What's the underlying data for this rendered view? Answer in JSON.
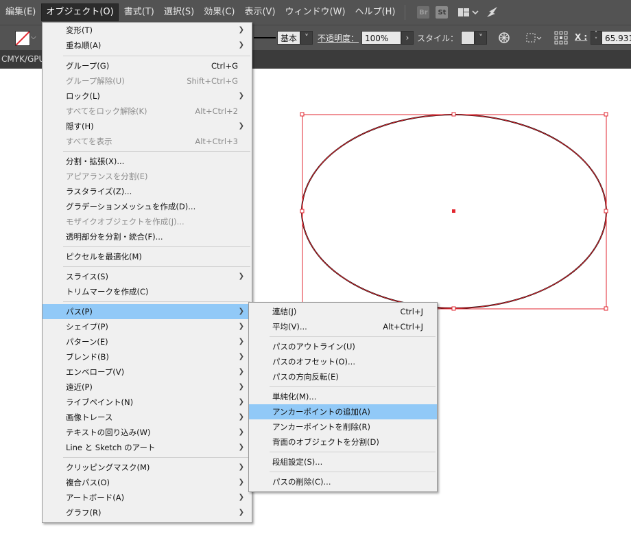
{
  "menubar": {
    "items": [
      "編集(E)",
      "オブジェクト(O)",
      "書式(T)",
      "選択(S)",
      "効果(C)",
      "表示(V)",
      "ウィンドウ(W)",
      "ヘルプ(H)"
    ],
    "active_index": 1,
    "bridge_icon": "Br",
    "stock_icon": "St"
  },
  "controlbar": {
    "stroke_profile_label": "基本",
    "opacity_label": "不透明度：",
    "opacity_value": "100%",
    "style_label": "スタイル：",
    "x_label": "X :",
    "x_value": "65.931"
  },
  "document": {
    "tab_title": "CMYK/GPU"
  },
  "object_menu": {
    "items": [
      {
        "label": "変形(T)",
        "shortcut": "",
        "submenu": true,
        "enabled": true
      },
      {
        "label": "重ね順(A)",
        "shortcut": "",
        "submenu": true,
        "enabled": true
      },
      {
        "label": "グループ(G)",
        "shortcut": "Ctrl+G",
        "submenu": false,
        "enabled": true
      },
      {
        "label": "グループ解除(U)",
        "shortcut": "Shift+Ctrl+G",
        "submenu": false,
        "enabled": false
      },
      {
        "label": "ロック(L)",
        "shortcut": "",
        "submenu": true,
        "enabled": true
      },
      {
        "label": "すべてをロック解除(K)",
        "shortcut": "Alt+Ctrl+2",
        "submenu": false,
        "enabled": false
      },
      {
        "label": "隠す(H)",
        "shortcut": "",
        "submenu": true,
        "enabled": true
      },
      {
        "label": "すべてを表示",
        "shortcut": "Alt+Ctrl+3",
        "submenu": false,
        "enabled": false
      },
      {
        "label": "分割・拡張(X)...",
        "shortcut": "",
        "submenu": false,
        "enabled": true
      },
      {
        "label": "アピアランスを分割(E)",
        "shortcut": "",
        "submenu": false,
        "enabled": false
      },
      {
        "label": "ラスタライズ(Z)...",
        "shortcut": "",
        "submenu": false,
        "enabled": true
      },
      {
        "label": "グラデーションメッシュを作成(D)...",
        "shortcut": "",
        "submenu": false,
        "enabled": true
      },
      {
        "label": "モザイクオブジェクトを作成(J)...",
        "shortcut": "",
        "submenu": false,
        "enabled": false
      },
      {
        "label": "透明部分を分割・統合(F)...",
        "shortcut": "",
        "submenu": false,
        "enabled": true
      },
      {
        "label": "ピクセルを最適化(M)",
        "shortcut": "",
        "submenu": false,
        "enabled": true
      },
      {
        "label": "スライス(S)",
        "shortcut": "",
        "submenu": true,
        "enabled": true
      },
      {
        "label": "トリムマークを作成(C)",
        "shortcut": "",
        "submenu": false,
        "enabled": true
      },
      {
        "label": "パス(P)",
        "shortcut": "",
        "submenu": true,
        "enabled": true,
        "highlighted": true
      },
      {
        "label": "シェイプ(P)",
        "shortcut": "",
        "submenu": true,
        "enabled": true
      },
      {
        "label": "パターン(E)",
        "shortcut": "",
        "submenu": true,
        "enabled": true
      },
      {
        "label": "ブレンド(B)",
        "shortcut": "",
        "submenu": true,
        "enabled": true
      },
      {
        "label": "エンベロープ(V)",
        "shortcut": "",
        "submenu": true,
        "enabled": true
      },
      {
        "label": "遠近(P)",
        "shortcut": "",
        "submenu": true,
        "enabled": true
      },
      {
        "label": "ライブペイント(N)",
        "shortcut": "",
        "submenu": true,
        "enabled": true
      },
      {
        "label": "画像トレース",
        "shortcut": "",
        "submenu": true,
        "enabled": true
      },
      {
        "label": "テキストの回り込み(W)",
        "shortcut": "",
        "submenu": true,
        "enabled": true
      },
      {
        "label": "Line と Sketch のアート",
        "shortcut": "",
        "submenu": true,
        "enabled": true
      },
      {
        "label": "クリッピングマスク(M)",
        "shortcut": "",
        "submenu": true,
        "enabled": true
      },
      {
        "label": "複合パス(O)",
        "shortcut": "",
        "submenu": true,
        "enabled": true
      },
      {
        "label": "アートボード(A)",
        "shortcut": "",
        "submenu": true,
        "enabled": true
      },
      {
        "label": "グラフ(R)",
        "shortcut": "",
        "submenu": true,
        "enabled": true
      }
    ]
  },
  "path_submenu": {
    "items": [
      {
        "label": "連結(J)",
        "shortcut": "Ctrl+J"
      },
      {
        "label": "平均(V)...",
        "shortcut": "Alt+Ctrl+J"
      },
      {
        "label": "パスのアウトライン(U)",
        "shortcut": ""
      },
      {
        "label": "パスのオフセット(O)...",
        "shortcut": ""
      },
      {
        "label": "パスの方向反転(E)",
        "shortcut": ""
      },
      {
        "label": "単純化(M)...",
        "shortcut": ""
      },
      {
        "label": "アンカーポイントの追加(A)",
        "shortcut": "",
        "highlighted": true
      },
      {
        "label": "アンカーポイントを削除(R)",
        "shortcut": ""
      },
      {
        "label": "背面のオブジェクトを分割(D)",
        "shortcut": ""
      },
      {
        "label": "段組設定(S)...",
        "shortcut": ""
      },
      {
        "label": "パスの削除(C)...",
        "shortcut": ""
      }
    ]
  },
  "colors": {
    "ui_dark": "#535353",
    "menu_bg": "#f0f0f0",
    "highlight": "#91c9f7",
    "selection": "#e2262f"
  }
}
